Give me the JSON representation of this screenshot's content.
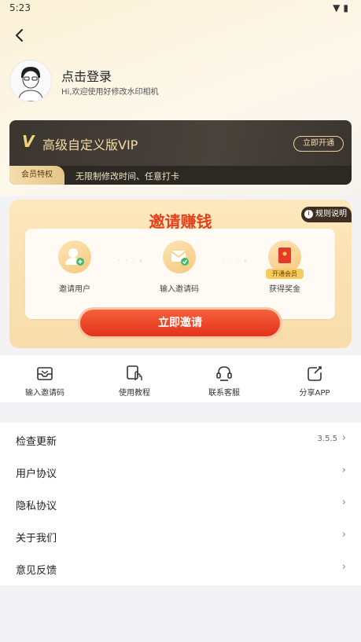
{
  "status": {
    "time": "5:23"
  },
  "profile": {
    "title": "点击登录",
    "subtitle": "Hi,欢迎使用好修改水印相机"
  },
  "vip": {
    "title": "高级自定义版VIP",
    "open_button": "立即开通",
    "tag": "会员特权",
    "desc": "无限制修改时间、任意打卡"
  },
  "invite": {
    "title": "邀请赚钱",
    "rules": "规则说明",
    "steps": [
      {
        "label": "邀请用户",
        "icon": "add-user-icon"
      },
      {
        "label": "输入邀请码",
        "icon": "envelope-check-icon"
      },
      {
        "label": "获得奖金",
        "icon": "red-envelope-icon",
        "badge": "开通会员"
      }
    ],
    "button": "立即邀请"
  },
  "quick": [
    {
      "label": "输入邀请码",
      "icon": "inbox-icon"
    },
    {
      "label": "使用教程",
      "icon": "tap-icon"
    },
    {
      "label": "联系客服",
      "icon": "headset-icon"
    },
    {
      "label": "分享APP",
      "icon": "share-icon"
    }
  ],
  "menu": [
    {
      "label": "检查更新",
      "value": "3.5.5"
    },
    {
      "label": "用户协议",
      "value": ""
    },
    {
      "label": "隐私协议",
      "value": ""
    },
    {
      "label": "关于我们",
      "value": ""
    },
    {
      "label": "意见反馈",
      "value": ""
    }
  ],
  "colors": {
    "accent": "#e2411d",
    "vip_gold": "#f6dba1"
  }
}
